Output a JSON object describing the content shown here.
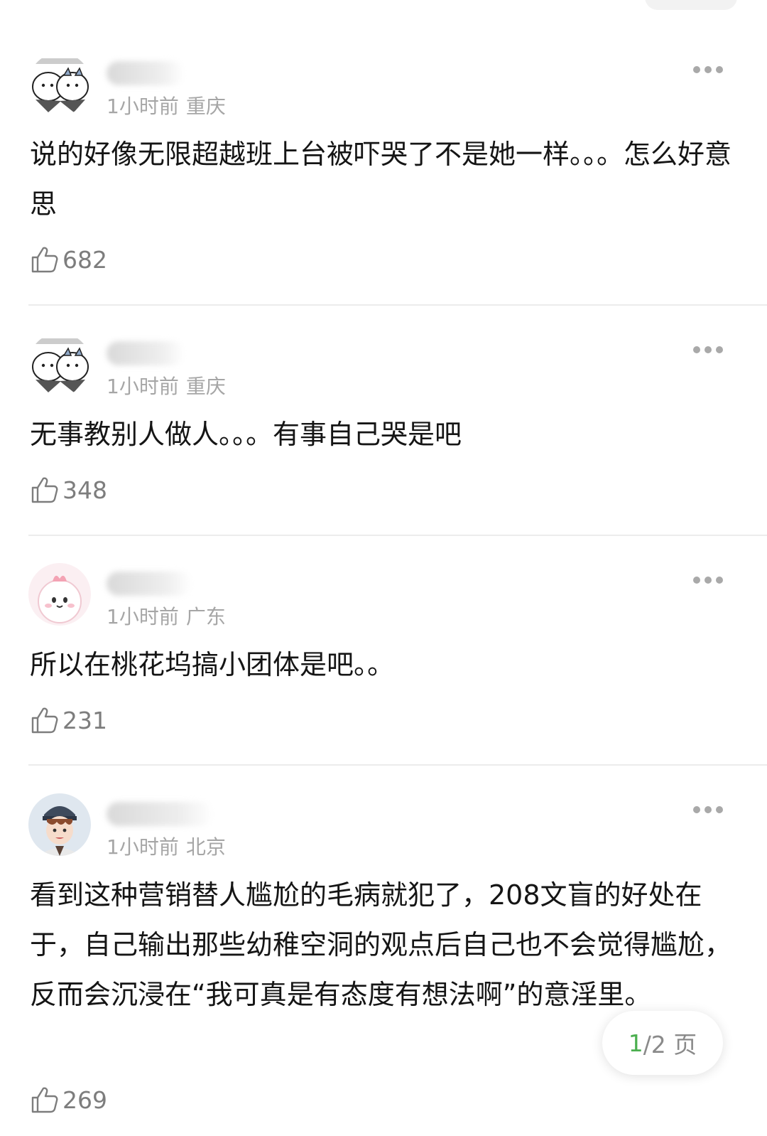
{
  "comments": [
    {
      "time": "1小时前",
      "location": "重庆",
      "text": "说的好像无限超越班上台被吓哭了不是她一样。。。怎么好意思",
      "likes": "682",
      "avatar": "cartoon-animals-icon"
    },
    {
      "time": "1小时前",
      "location": "重庆",
      "text": "无事教别人做人。。。有事自己哭是吧",
      "likes": "348",
      "avatar": "cartoon-animals-icon"
    },
    {
      "time": "1小时前",
      "location": "广东",
      "text": "所以在桃花坞搞小团体是吧。。",
      "likes": "231",
      "avatar": "pink-creature-icon"
    },
    {
      "time": "1小时前",
      "location": "北京",
      "text": "看到这种营销替人尴尬的毛病就犯了，208文盲的好处在于，自己输出那些幼稚空洞的观点后自己也不会觉得尴尬，反而会沉浸在“我可真是有态度有想法啊”的意淫里。",
      "likes": "269",
      "avatar": "anime-boy-icon"
    }
  ],
  "pager": {
    "current": "1",
    "total": "/2 页"
  },
  "colors": {
    "accent": "#4caf50",
    "meta_text": "#a6a6a6",
    "divider": "#ececec"
  }
}
